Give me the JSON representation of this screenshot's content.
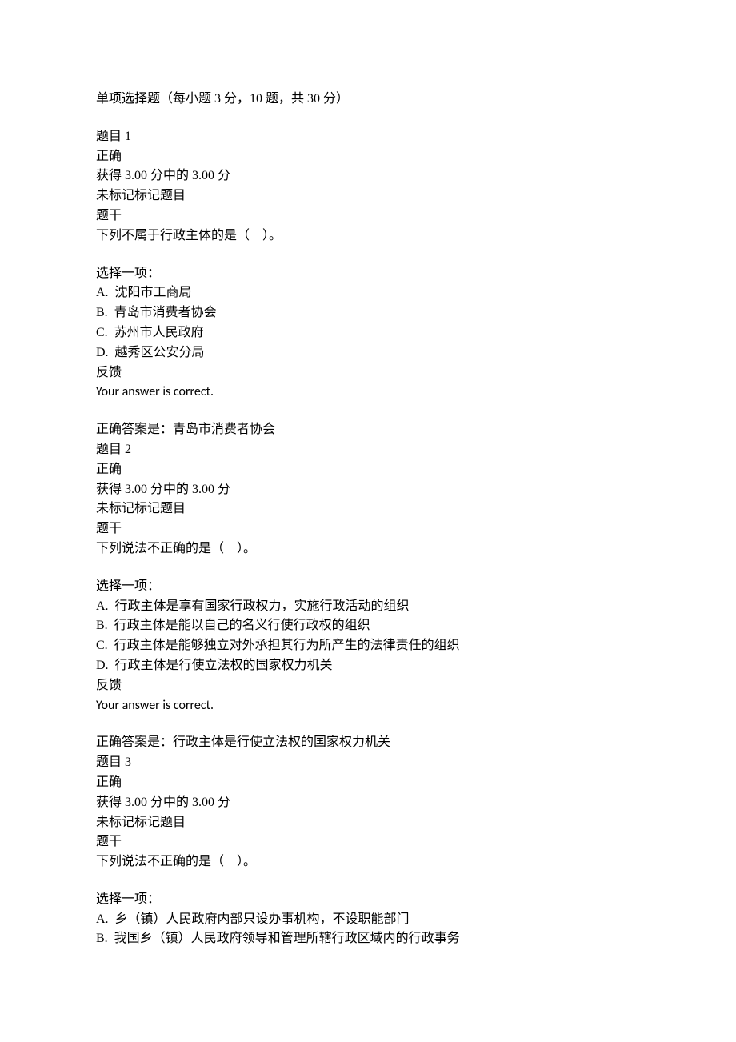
{
  "header": "单项选择题（每小题 3 分，10 题，共 30 分）",
  "questions": [
    {
      "label": "题目 1",
      "status": "正确",
      "score": "获得 3.00 分中的 3.00 分",
      "flag": "未标记标记题目",
      "stem_label": "题干",
      "stem": "下列不属于行政主体的是（　）。",
      "prompt": "选择一项：",
      "optionA": "A.  沈阳市工商局",
      "optionB": "B.  青岛市消费者协会",
      "optionC": "C.  苏州市人民政府",
      "optionD": "D.  越秀区公安分局",
      "feedback_label": "反馈",
      "feedback": "Your answer is correct.",
      "correct": "正确答案是：青岛市消费者协会"
    },
    {
      "label": "题目 2",
      "status": "正确",
      "score": "获得 3.00 分中的 3.00 分",
      "flag": "未标记标记题目",
      "stem_label": "题干",
      "stem": "下列说法不正确的是（　）。",
      "prompt": "选择一项：",
      "optionA": "A.  行政主体是享有国家行政权力，实施行政活动的组织",
      "optionB": "B.  行政主体是能以自己的名义行使行政权的组织",
      "optionC": "C.  行政主体是能够独立对外承担其行为所产生的法律责任的组织",
      "optionD": "D.  行政主体是行使立法权的国家权力机关",
      "feedback_label": "反馈",
      "feedback": "Your answer is correct.",
      "correct": "正确答案是：行政主体是行使立法权的国家权力机关"
    },
    {
      "label": "题目 3",
      "status": "正确",
      "score": "获得 3.00 分中的 3.00 分",
      "flag": "未标记标记题目",
      "stem_label": "题干",
      "stem": "下列说法不正确的是（　）。",
      "prompt": "选择一项：",
      "optionA": "A.  乡（镇）人民政府内部只设办事机构，不设职能部门",
      "optionB": "B.  我国乡（镇）人民政府领导和管理所辖行政区域内的行政事务"
    }
  ]
}
